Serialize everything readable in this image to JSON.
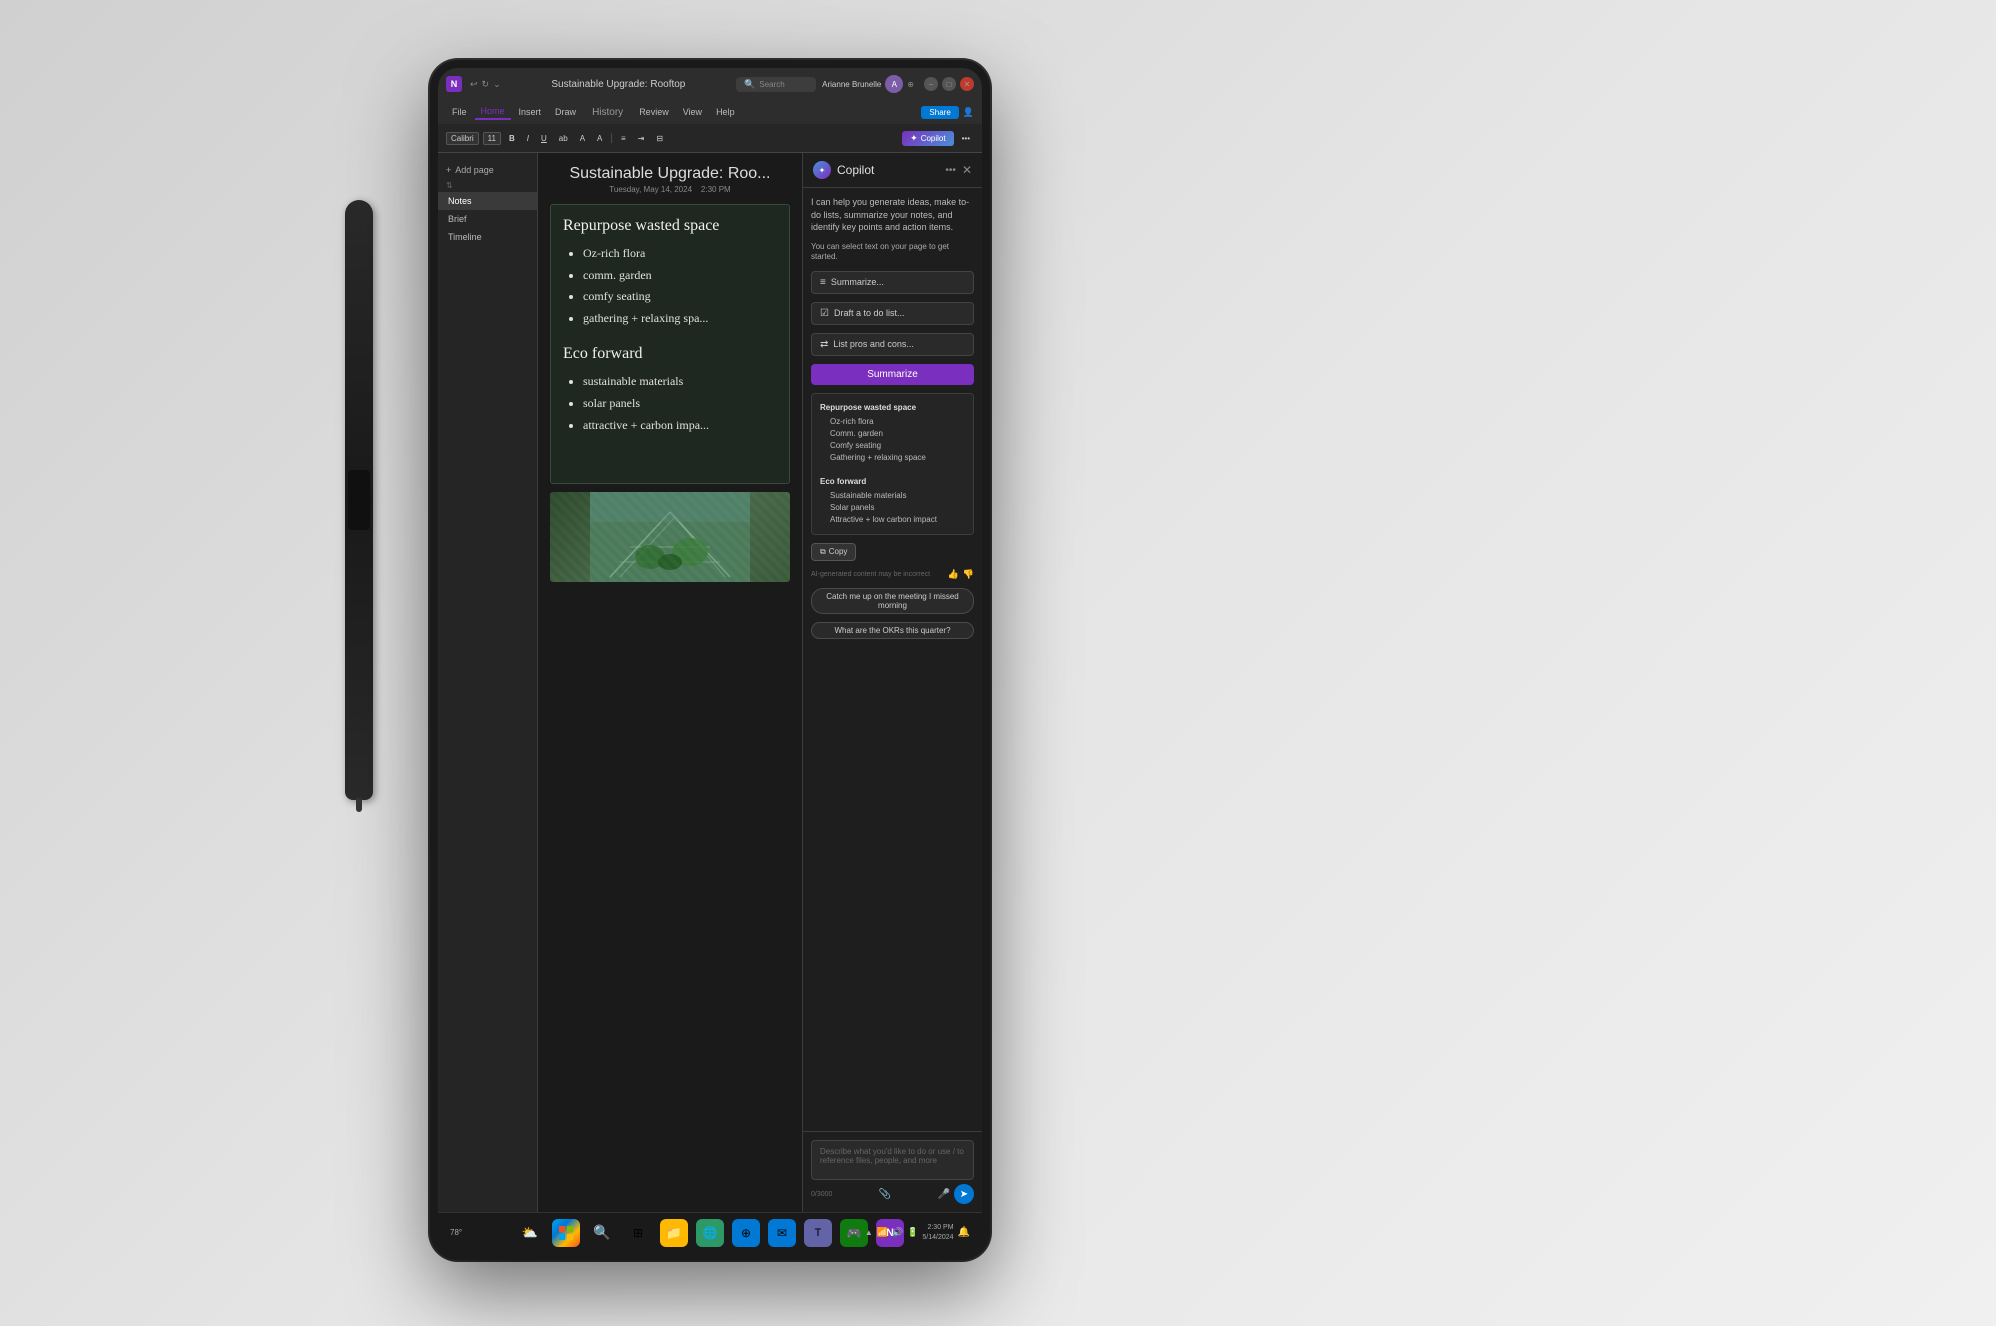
{
  "background": {
    "color": "#e8e8e8"
  },
  "titlebar": {
    "app_icon": "N",
    "title": "Sustainable Upgrade: Rooftop",
    "search_placeholder": "Search",
    "user_name": "Arianne Brunelle",
    "controls": [
      "minimize",
      "maximize",
      "close"
    ]
  },
  "ribbon": {
    "tabs": [
      "File",
      "Home",
      "Insert",
      "Draw",
      "History",
      "Review",
      "View",
      "Help"
    ],
    "active_tab": "Home",
    "copilot_label": "Copilot",
    "share_label": "Share",
    "font_family": "Calibri",
    "font_size": "11",
    "formatting": [
      "B",
      "I",
      "U",
      "ab",
      "A"
    ]
  },
  "sidebar": {
    "add_page_label": "Add page",
    "items": [
      {
        "label": "Notes",
        "active": true
      },
      {
        "label": "Brief"
      },
      {
        "label": "Timeline"
      }
    ]
  },
  "note": {
    "title": "Sustainable Upgrade: Roo...",
    "date": "Tuesday, May 14, 2024",
    "time": "2:30 PM",
    "handwriting_title1": "Repurpose wasted space",
    "bullets1": [
      "Oz-rich flora",
      "comm. garden",
      "comfy seating",
      "gathering + relaxing spa..."
    ],
    "handwriting_title2": "Eco forward",
    "bullets2": [
      "sustainable materials",
      "solar panels",
      "attractive + carbon impa..."
    ]
  },
  "copilot": {
    "title": "Copilot",
    "close_label": "✕",
    "more_label": "...",
    "intro_text": "I can help you generate ideas, make to-do lists, summarize your notes, and identify key points and action items.",
    "select_hint": "You can select text on your page to get started.",
    "suggestions": [
      {
        "icon": "≡",
        "label": "Summarize..."
      },
      {
        "icon": "☑",
        "label": "Draft a to do list..."
      },
      {
        "icon": "⇄",
        "label": "List pros and cons..."
      }
    ],
    "summarize_btn": "Summarize",
    "summary": {
      "section1_title": "Repurpose wasted space",
      "section1_bullets": [
        "Oz-rich flora",
        "Comm. garden",
        "Comfy seating",
        "Gathering + relaxing space"
      ],
      "section2_title": "Eco forward",
      "section2_bullets": [
        "Sustainable materials",
        "Solar panels",
        "Attractive + low carbon impact"
      ]
    },
    "copy_label": "Copy",
    "ai_disclaimer": "AI-generated content may be incorrect",
    "prompt_chips": [
      "Catch me up on the meeting I missed morning",
      "What are the OKRs this quarter?"
    ],
    "input_placeholder": "Describe what you'd like to do or use / to reference files, people, and more",
    "char_count": "0/3000"
  },
  "taskbar": {
    "temperature": "78°",
    "time": "2:30 PM",
    "date": "5/14/2024",
    "icons": [
      "weather",
      "windows",
      "search",
      "task-view",
      "explorer",
      "browser",
      "edge",
      "outlook",
      "teams",
      "xbox",
      "onenote",
      "notifications"
    ]
  }
}
